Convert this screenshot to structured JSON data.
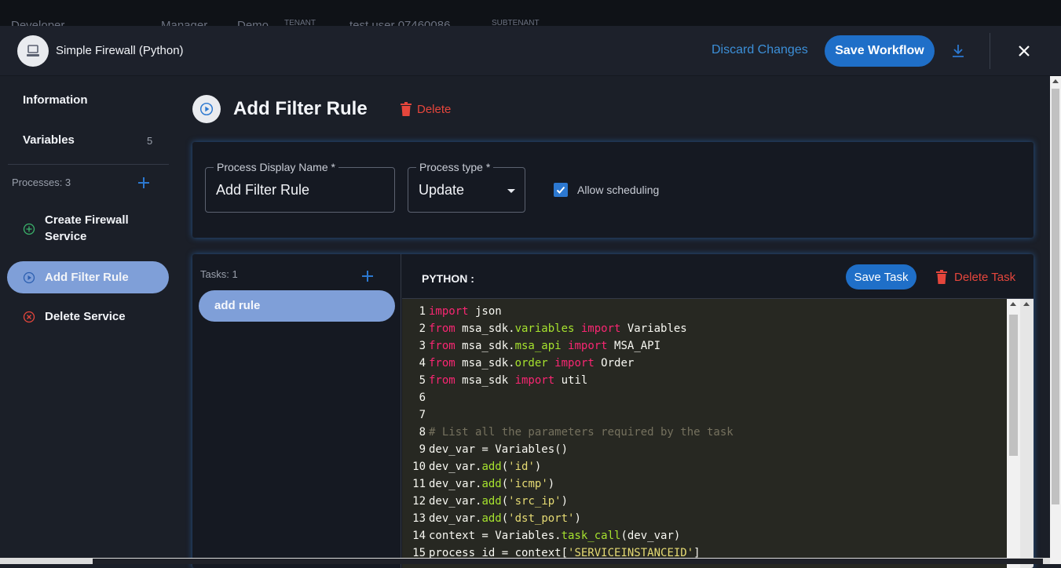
{
  "topbar": {
    "brand": "Developer",
    "breadcrumbs": [
      "Manager",
      "Demo",
      "TENANT",
      "test user 07460086",
      "SUBTENANT"
    ]
  },
  "header": {
    "workflow_name": "Simple Firewall (Python)",
    "discard_label": "Discard Changes",
    "save_label": "Save Workflow",
    "accent": "#1f6fc8"
  },
  "sidebar": {
    "information_label": "Information",
    "variables_label": "Variables",
    "variables_count": "5",
    "processes_label": "Processes: 3",
    "processes": [
      {
        "label": "Create Firewall Service",
        "icon": "plus-circle-icon",
        "color": "#3bb36b"
      },
      {
        "label": "Add Filter Rule",
        "icon": "play-circle-icon",
        "color": "#2c78d0",
        "active": true
      },
      {
        "label": "Delete Service",
        "icon": "x-circle-icon",
        "color": "#e5463c"
      }
    ]
  },
  "process": {
    "title": "Add Filter Rule",
    "delete_label": "Delete",
    "display_name_label": "Process Display Name *",
    "display_name_value": "Add Filter Rule",
    "type_label": "Process type *",
    "type_value": "Update",
    "allow_scheduling_label": "Allow scheduling",
    "allow_scheduling_checked": true
  },
  "tasks": {
    "label": "Tasks: 1",
    "items": [
      {
        "label": "add rule"
      }
    ]
  },
  "editor": {
    "language_label": "PYTHON :",
    "save_task_label": "Save Task",
    "delete_task_label": "Delete Task",
    "lines": [
      [
        {
          "t": "import",
          "c": "kw"
        },
        {
          "t": " json",
          "c": "tx"
        }
      ],
      [
        {
          "t": "from",
          "c": "kw"
        },
        {
          "t": " msa_sdk.",
          "c": "tx"
        },
        {
          "t": "variables",
          "c": "fn"
        },
        {
          "t": " ",
          "c": "tx"
        },
        {
          "t": "import",
          "c": "kw"
        },
        {
          "t": " Variables",
          "c": "tx"
        }
      ],
      [
        {
          "t": "from",
          "c": "kw"
        },
        {
          "t": " msa_sdk.",
          "c": "tx"
        },
        {
          "t": "msa_api",
          "c": "fn"
        },
        {
          "t": " ",
          "c": "tx"
        },
        {
          "t": "import",
          "c": "kw"
        },
        {
          "t": " MSA_API",
          "c": "tx"
        }
      ],
      [
        {
          "t": "from",
          "c": "kw"
        },
        {
          "t": " msa_sdk.",
          "c": "tx"
        },
        {
          "t": "order",
          "c": "fn"
        },
        {
          "t": " ",
          "c": "tx"
        },
        {
          "t": "import",
          "c": "kw"
        },
        {
          "t": " Order",
          "c": "tx"
        }
      ],
      [
        {
          "t": "from",
          "c": "kw"
        },
        {
          "t": " msa_sdk ",
          "c": "tx"
        },
        {
          "t": "import",
          "c": "kw"
        },
        {
          "t": " util",
          "c": "tx"
        }
      ],
      [],
      [],
      [
        {
          "t": "# List all the parameters required by the task",
          "c": "cm"
        }
      ],
      [
        {
          "t": "dev_var = Variables()",
          "c": "tx"
        }
      ],
      [
        {
          "t": "dev_var.",
          "c": "tx"
        },
        {
          "t": "add",
          "c": "fn"
        },
        {
          "t": "(",
          "c": "tx"
        },
        {
          "t": "'id'",
          "c": "str"
        },
        {
          "t": ")",
          "c": "tx"
        }
      ],
      [
        {
          "t": "dev_var.",
          "c": "tx"
        },
        {
          "t": "add",
          "c": "fn"
        },
        {
          "t": "(",
          "c": "tx"
        },
        {
          "t": "'icmp'",
          "c": "str"
        },
        {
          "t": ")",
          "c": "tx"
        }
      ],
      [
        {
          "t": "dev_var.",
          "c": "tx"
        },
        {
          "t": "add",
          "c": "fn"
        },
        {
          "t": "(",
          "c": "tx"
        },
        {
          "t": "'src_ip'",
          "c": "str"
        },
        {
          "t": ")",
          "c": "tx"
        }
      ],
      [
        {
          "t": "dev_var.",
          "c": "tx"
        },
        {
          "t": "add",
          "c": "fn"
        },
        {
          "t": "(",
          "c": "tx"
        },
        {
          "t": "'dst_port'",
          "c": "str"
        },
        {
          "t": ")",
          "c": "tx"
        }
      ],
      [
        {
          "t": "context = Variables.",
          "c": "tx"
        },
        {
          "t": "task_call",
          "c": "fn"
        },
        {
          "t": "(dev_var)",
          "c": "tx"
        }
      ],
      [
        {
          "t": "process_id = context[",
          "c": "tx"
        },
        {
          "t": "'SERVICEINSTANCEID'",
          "c": "str"
        },
        {
          "t": "]",
          "c": "tx"
        }
      ]
    ]
  }
}
